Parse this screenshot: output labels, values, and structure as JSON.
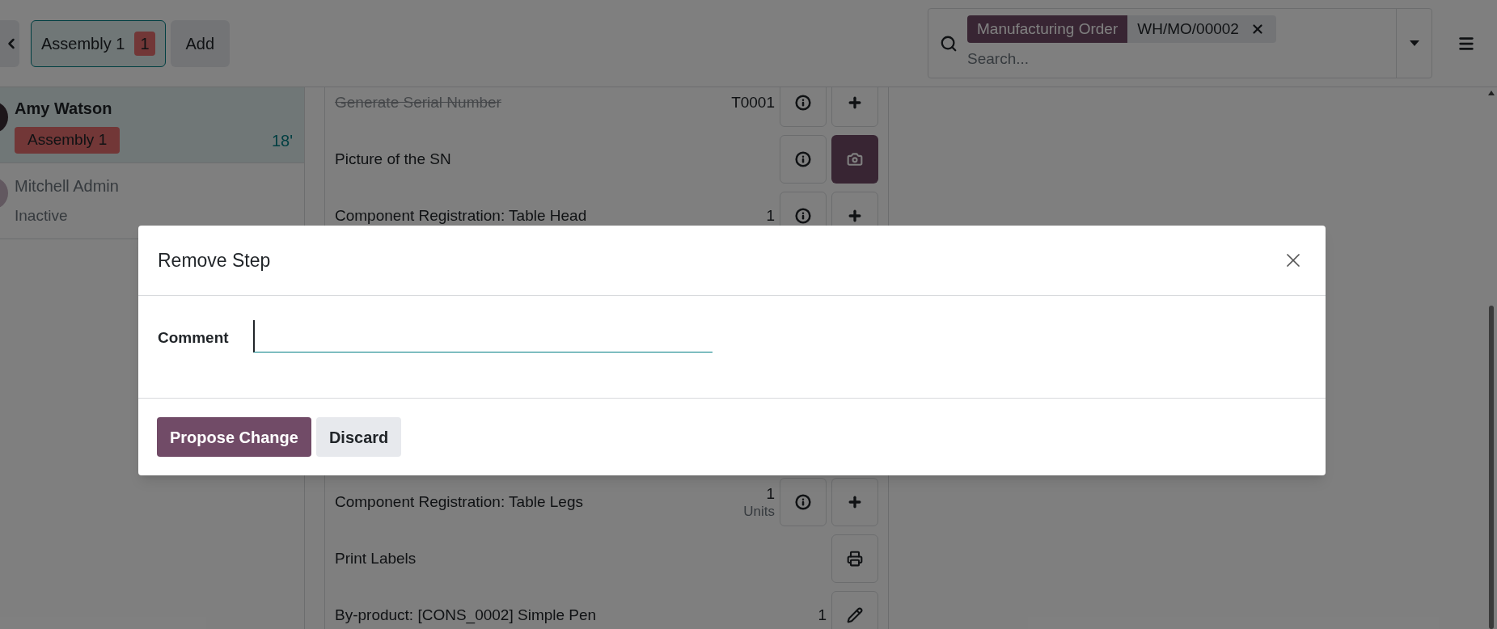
{
  "toolbar": {
    "tabs": [
      {
        "label": "Assembly 1",
        "count": "1",
        "selected": true
      }
    ],
    "add_label": "Add"
  },
  "search": {
    "facets": [
      {
        "field": "Manufacturing Order",
        "value": "WH/MO/00002"
      }
    ],
    "placeholder": "Search..."
  },
  "operators": [
    {
      "name": "Amy Watson",
      "tag": "Assembly 1",
      "time": "18'",
      "selected": true
    },
    {
      "name": "Mitchell Admin",
      "status": "Inactive",
      "selected": false
    }
  ],
  "steps": [
    {
      "label": "Generate Serial Number",
      "done": true,
      "value": "T0001",
      "actions": [
        {
          "kind": "info",
          "highlighted": false
        },
        {
          "kind": "add",
          "highlighted": false
        }
      ]
    },
    {
      "label": "Picture of the SN",
      "done": false,
      "actions": [
        {
          "kind": "info",
          "highlighted": false
        },
        {
          "kind": "camera",
          "highlighted": true
        }
      ]
    },
    {
      "label": "Component Registration: Table Head",
      "done": false,
      "value": "1",
      "actions": [
        {
          "kind": "info",
          "highlighted": false
        },
        {
          "kind": "add",
          "highlighted": false
        }
      ]
    },
    {
      "label": "Component Registration: Table Legs",
      "done": false,
      "value": "1",
      "unit": "Units",
      "actions": [
        {
          "kind": "info",
          "highlighted": false
        },
        {
          "kind": "add",
          "highlighted": false
        }
      ]
    },
    {
      "label": "Print Labels",
      "done": false,
      "actions": [
        {
          "kind": "print",
          "highlighted": false
        }
      ]
    },
    {
      "label": "By-product: [CONS_0002] Simple Pen",
      "done": false,
      "value": "1",
      "actions": [
        {
          "kind": "edit",
          "highlighted": false
        }
      ]
    }
  ],
  "dialog": {
    "title": "Remove Step",
    "field_label": "Comment",
    "primary_button": "Propose Change",
    "secondary_button": "Discard"
  }
}
